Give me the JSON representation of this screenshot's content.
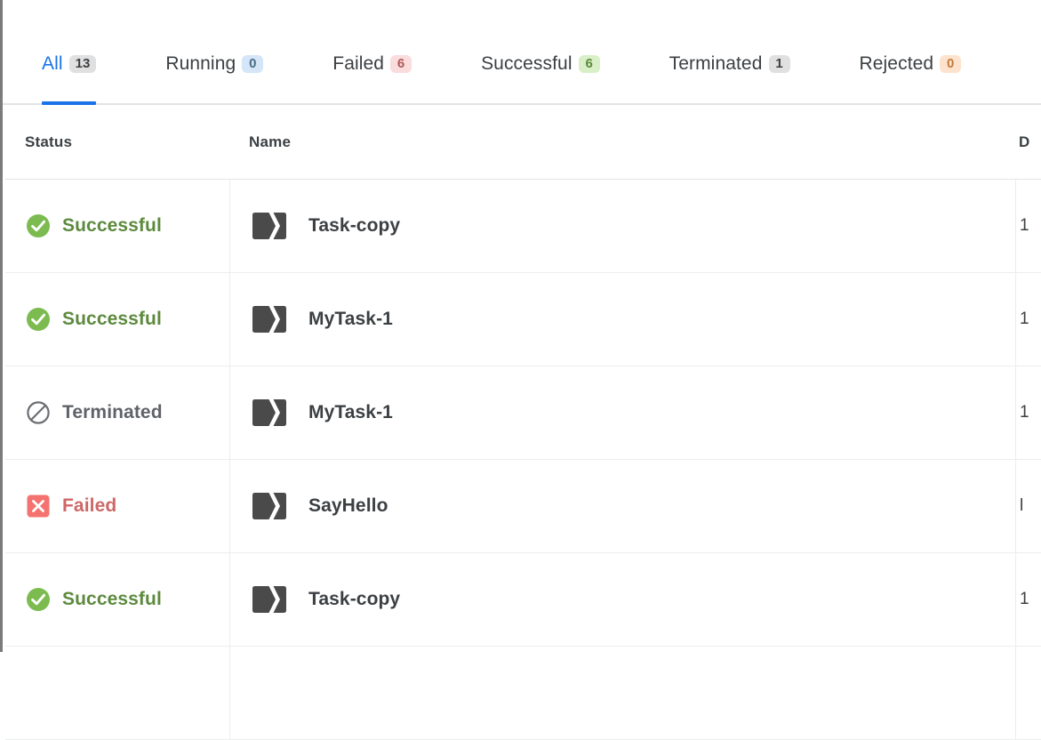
{
  "tabs": [
    {
      "label": "All",
      "count": "13",
      "badge_style": "badge-gray",
      "active": true
    },
    {
      "label": "Running",
      "count": "0",
      "badge_style": "badge-blue",
      "active": false
    },
    {
      "label": "Failed",
      "count": "6",
      "badge_style": "badge-red",
      "active": false
    },
    {
      "label": "Successful",
      "count": "6",
      "badge_style": "badge-green",
      "active": false
    },
    {
      "label": "Terminated",
      "count": "1",
      "badge_style": "badge-gray",
      "active": false
    },
    {
      "label": "Rejected",
      "count": "0",
      "badge_style": "badge-orange",
      "active": false
    }
  ],
  "table": {
    "columns": {
      "status": "Status",
      "name": "Name",
      "date": "D"
    },
    "rows": [
      {
        "status": "Successful",
        "status_kind": "successful",
        "name": "Task-copy",
        "date": "1"
      },
      {
        "status": "Successful",
        "status_kind": "successful",
        "name": "MyTask-1",
        "date": "1"
      },
      {
        "status": "Terminated",
        "status_kind": "terminated",
        "name": "MyTask-1",
        "date": "1"
      },
      {
        "status": "Failed",
        "status_kind": "failed",
        "name": "SayHello",
        "date": "l"
      },
      {
        "status": "Successful",
        "status_kind": "successful",
        "name": "Task-copy",
        "date": "1"
      }
    ]
  },
  "colors": {
    "accent": "#1a73e8",
    "successful": "#7cbb4f",
    "terminated": "#5f6368",
    "failed": "#f4726f",
    "task_icon": "#4a4a4a"
  }
}
